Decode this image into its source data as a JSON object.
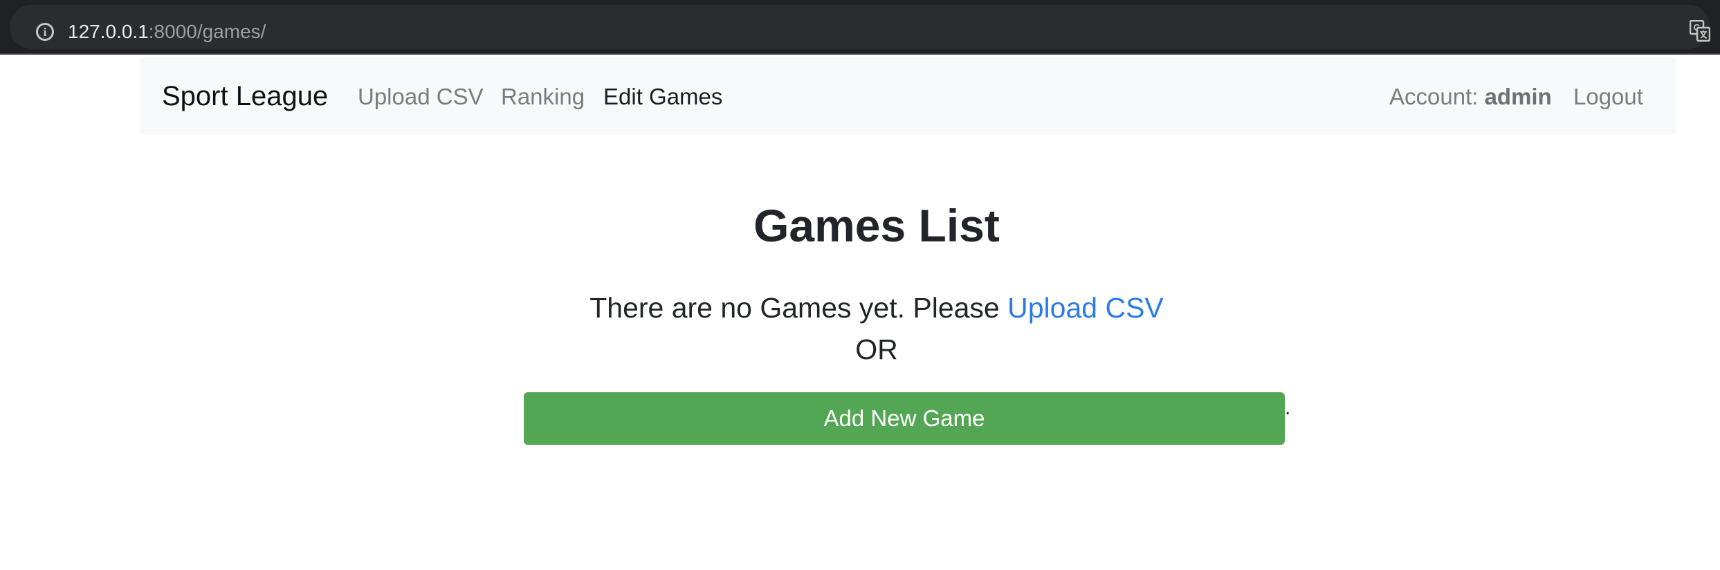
{
  "browser": {
    "url_host": "127.0.0.1",
    "url_path": ":8000/games/"
  },
  "navbar": {
    "brand": "Sport League",
    "links": [
      {
        "label": "Upload CSV"
      },
      {
        "label": "Ranking"
      },
      {
        "label": "Edit Games"
      }
    ],
    "account_prefix": "Account: ",
    "account_user": "admin",
    "logout": "Logout"
  },
  "main": {
    "title": "Games List",
    "message": "There are no Games yet. Please ",
    "upload_link": "Upload CSV",
    "or_text": "OR",
    "add_button": "Add New Game",
    "trailing_dot": "."
  },
  "colors": {
    "browser_bg": "#202124",
    "navbar_bg": "#f8f9fa",
    "link_blue": "#2c7be5",
    "button_green": "#53a653"
  }
}
